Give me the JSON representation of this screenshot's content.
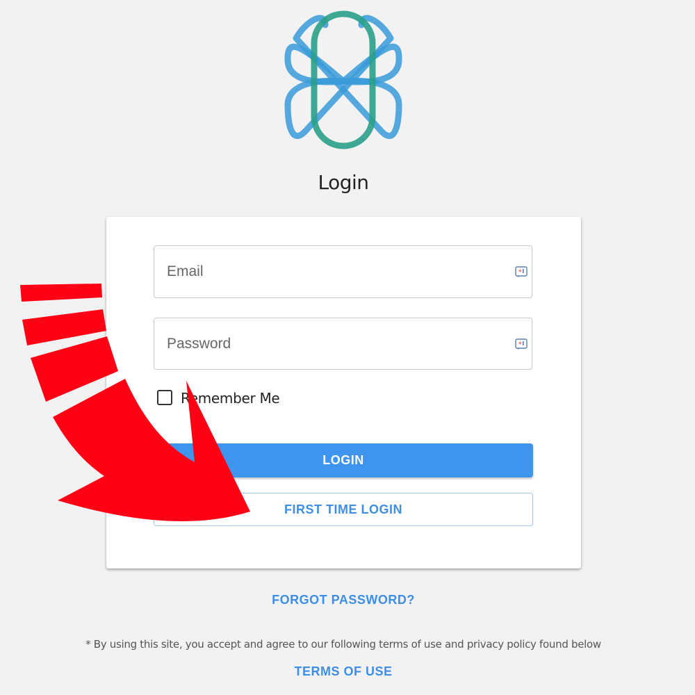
{
  "header": {
    "title": "Login",
    "logo_icon": "intertwined-loops-logo",
    "logo_colors": [
      "#3a9bd9",
      "#2aa08a"
    ]
  },
  "form": {
    "email_placeholder": "Email",
    "password_placeholder": "Password",
    "autofill_icon": "password-manager-icon",
    "remember_label": "Remember Me",
    "remember_checked": false,
    "login_button": "LOGIN",
    "first_time_button": "FIRST TIME LOGIN"
  },
  "links": {
    "forgot_password": "FORGOT PASSWORD?",
    "disclaimer": "* By using this site, you accept and agree to our following terms of use and privacy policy found below",
    "terms": "TERMS OF USE"
  },
  "overlay": {
    "annotation_icon": "red-curved-arrow-icon",
    "color": "#ff0015"
  },
  "colors": {
    "accent": "#3f95ed",
    "link": "#3f8ee6",
    "background": "#f2f2f2"
  }
}
